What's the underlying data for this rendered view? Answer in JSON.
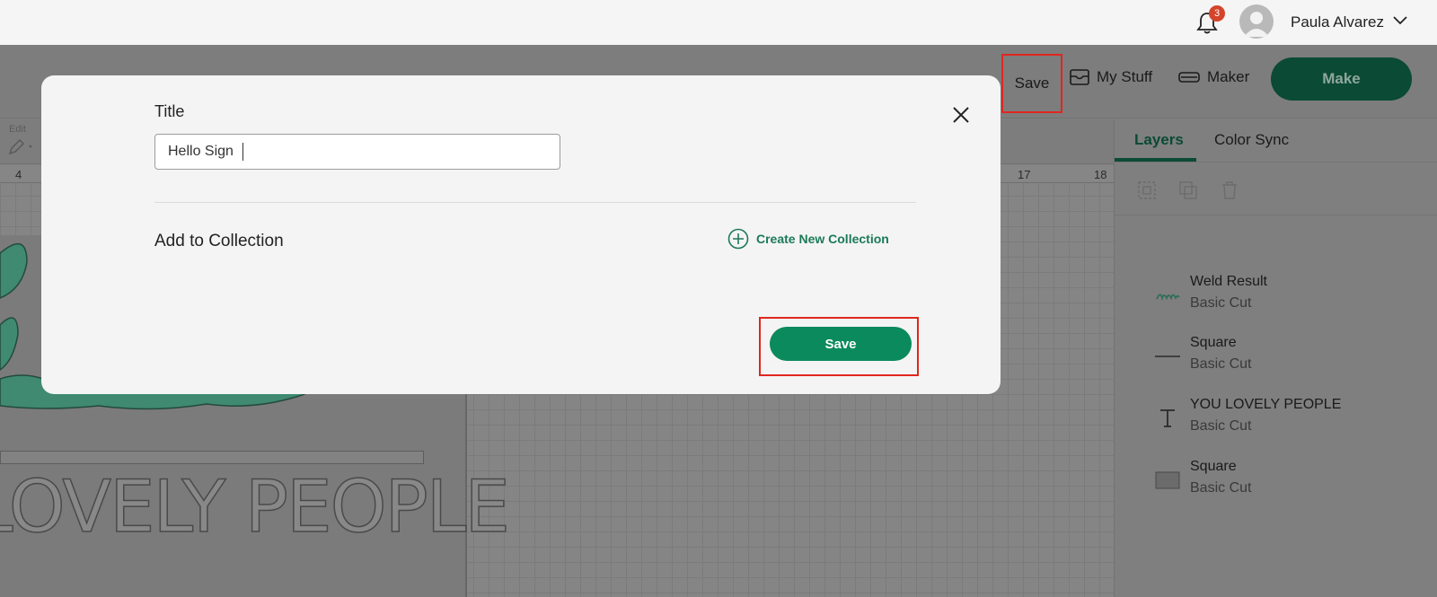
{
  "topbar": {
    "notification_count": "3",
    "user_name": "Paula Alvarez"
  },
  "header": {
    "save_label": "Save",
    "my_stuff_label": "My Stuff",
    "maker_label": "Maker",
    "make_label": "Make"
  },
  "edit_bar": {
    "edit_label": "Edit"
  },
  "ruler": {
    "ticks": [
      "4",
      "17",
      "18"
    ]
  },
  "canvas": {
    "mat_text": "LOVELY PEOPLE"
  },
  "panel": {
    "tabs": [
      {
        "label": "Layers",
        "active": true
      },
      {
        "label": "Color Sync",
        "active": false
      }
    ],
    "layers": [
      {
        "name": "Weld Result",
        "operation": "Basic Cut",
        "icon": "script-hello-thumb"
      },
      {
        "name": "Square",
        "operation": "Basic Cut",
        "icon": "line-thumb"
      },
      {
        "name": "YOU LOVELY PEOPLE",
        "operation": "Basic Cut",
        "icon": "text-T-icon"
      },
      {
        "name": "Square",
        "operation": "Basic Cut",
        "icon": "square-thumb"
      }
    ]
  },
  "modal": {
    "title_label": "Title",
    "title_value": "Hello Sign",
    "collection_label": "Add to Collection",
    "create_collection_label": "Create New Collection",
    "save_label": "Save"
  },
  "colors": {
    "accent_green": "#0b8a5e",
    "dark_green": "#0b4a35",
    "highlight_red": "#e0271f",
    "badge_red": "#d4442b"
  }
}
